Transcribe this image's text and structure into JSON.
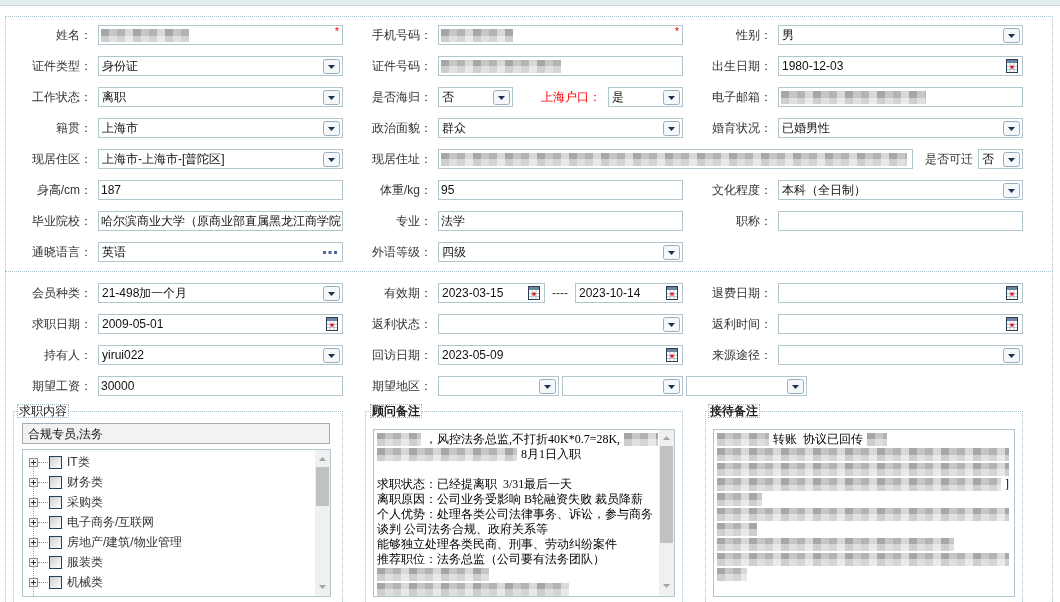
{
  "basic_info": {
    "rows": [
      [
        {
          "kind": "single",
          "label": "姓名：",
          "fields": [
            {
              "kind": "text",
              "redacted": true,
              "required_mark": "*"
            }
          ]
        },
        {
          "kind": "single",
          "label": "手机号码：",
          "fields": [
            {
              "kind": "text",
              "redacted": true,
              "required_mark": "*"
            }
          ]
        },
        {
          "kind": "single",
          "label": "性别：",
          "fields": [
            {
              "kind": "select",
              "value": "男"
            }
          ]
        }
      ],
      [
        {
          "kind": "single",
          "label": "证件类型：",
          "fields": [
            {
              "kind": "select",
              "value": "身份证"
            }
          ]
        },
        {
          "kind": "single",
          "label": "证件号码：",
          "fields": [
            {
              "kind": "text",
              "redacted": true
            }
          ]
        },
        {
          "kind": "single",
          "label": "出生日期：",
          "fields": [
            {
              "kind": "date",
              "value": "1980-12-03"
            }
          ]
        }
      ],
      [
        {
          "kind": "single",
          "label": "工作状态：",
          "fields": [
            {
              "kind": "select",
              "value": "离职"
            }
          ]
        },
        {
          "kind": "pair",
          "label": "是否海归：",
          "fields": [
            {
              "kind": "select",
              "value": "否"
            },
            {
              "kind": "label",
              "text": "上海户口：",
              "highlighted": true
            },
            {
              "kind": "select",
              "value": "是"
            }
          ]
        },
        {
          "kind": "single",
          "label": "电子邮箱：",
          "fields": [
            {
              "kind": "text",
              "redacted": true
            }
          ]
        }
      ],
      [
        {
          "kind": "single",
          "label": "籍贯：",
          "fields": [
            {
              "kind": "select",
              "value": "上海市"
            }
          ]
        },
        {
          "kind": "single",
          "label": "政治面貌：",
          "fields": [
            {
              "kind": "select",
              "value": "群众"
            }
          ]
        },
        {
          "kind": "single",
          "label": "婚育状况：",
          "fields": [
            {
              "kind": "select",
              "value": "已婚男性"
            }
          ]
        }
      ],
      [
        {
          "kind": "single",
          "label": "现居住区：",
          "fields": [
            {
              "kind": "select",
              "value": "上海市-上海市-[普陀区]"
            }
          ]
        },
        {
          "kind": "address",
          "label": "现居住址：",
          "fields": [
            {
              "kind": "text",
              "redacted": true
            },
            {
              "kind": "label",
              "text": "是否可迁",
              "highlighted": false
            },
            {
              "kind": "select",
              "value": "否"
            }
          ]
        }
      ],
      [
        {
          "kind": "single",
          "label": "身高/cm：",
          "fields": [
            {
              "kind": "text",
              "redacted": false,
              "value": "187"
            }
          ]
        },
        {
          "kind": "single",
          "label": "体重/kg：",
          "fields": [
            {
              "kind": "text",
              "redacted": false,
              "value": "95"
            }
          ]
        },
        {
          "kind": "single",
          "label": "文化程度：",
          "fields": [
            {
              "kind": "select",
              "value": "本科（全日制）"
            }
          ]
        }
      ],
      [
        {
          "kind": "single",
          "label": "毕业院校：",
          "fields": [
            {
              "kind": "text",
              "redacted": false,
              "value": "哈尔滨商业大学（原商业部直属黑龙江商学院"
            }
          ]
        },
        {
          "kind": "single",
          "label": "专业：",
          "fields": [
            {
              "kind": "text",
              "redacted": false,
              "value": "法学"
            }
          ]
        },
        {
          "kind": "single",
          "label": "职称：",
          "fields": [
            {
              "kind": "text",
              "redacted": false
            }
          ]
        }
      ],
      [
        {
          "kind": "single",
          "label": "通晓语言：",
          "fields": [
            {
              "kind": "lookup",
              "value": "英语"
            }
          ]
        },
        {
          "kind": "single",
          "label": "外语等级：",
          "fields": [
            {
              "kind": "select",
              "value": "四级"
            }
          ]
        }
      ]
    ]
  },
  "membership": {
    "rows": [
      [
        {
          "kind": "single",
          "label": "会员种类：",
          "fields": [
            {
              "kind": "select",
              "value": "21-498加一个月"
            }
          ]
        },
        {
          "kind": "range",
          "label": "有效期：",
          "fields": [
            {
              "kind": "date",
              "value": "2023-03-15"
            },
            {
              "kind": "separator",
              "text": "----"
            },
            {
              "kind": "date",
              "value": "2023-10-14"
            }
          ]
        },
        {
          "kind": "single",
          "label": "退费日期：",
          "fields": [
            {
              "kind": "date"
            }
          ]
        }
      ],
      [
        {
          "kind": "single",
          "label": "求职日期：",
          "fields": [
            {
              "kind": "date",
              "value": "2009-05-01"
            }
          ]
        },
        {
          "kind": "single",
          "label": "返利状态：",
          "fields": [
            {
              "kind": "select"
            }
          ]
        },
        {
          "kind": "single",
          "label": "返利时间：",
          "fields": [
            {
              "kind": "date"
            }
          ]
        }
      ],
      [
        {
          "kind": "single",
          "label": "持有人：",
          "fields": [
            {
              "kind": "select",
              "value": "yirui022"
            }
          ]
        },
        {
          "kind": "single",
          "label": "回访日期：",
          "fields": [
            {
              "kind": "date",
              "value": "2023-05-09"
            }
          ]
        },
        {
          "kind": "single",
          "label": "来源途径：",
          "fields": [
            {
              "kind": "select"
            }
          ]
        }
      ],
      [
        {
          "kind": "single",
          "label": "期望工资：",
          "fields": [
            {
              "kind": "text",
              "redacted": false,
              "value": "30000"
            }
          ]
        },
        {
          "kind": "region",
          "label": "期望地区：",
          "fields": [
            {
              "kind": "select"
            },
            {
              "kind": "select"
            },
            {
              "kind": "select"
            }
          ]
        }
      ]
    ]
  },
  "job_content": {
    "legend": "求职内容",
    "selection": "合规专员,法务",
    "tree": [
      {
        "label": "IT类",
        "expanded": false,
        "checked": false
      },
      {
        "label": "财务类",
        "expanded": false,
        "checked": false
      },
      {
        "label": "采购类",
        "expanded": false,
        "checked": false
      },
      {
        "label": "电子商务/互联网",
        "expanded": false,
        "checked": false
      },
      {
        "label": "房地产/建筑/物业管理",
        "expanded": false,
        "checked": false
      },
      {
        "label": "服装类",
        "expanded": false,
        "checked": false
      },
      {
        "label": "机械类",
        "expanded": false,
        "checked": false
      }
    ]
  },
  "consultant_notes": {
    "legend": "顾问备注",
    "lines": [
      {
        "kind": "text",
        "parts": [
          {
            "kind": "redacted"
          },
          {
            "kind": "text",
            "text": "，风控法务总监,不打折40K*0.7=28K,"
          },
          {
            "kind": "redacted"
          }
        ]
      },
      {
        "kind": "text",
        "parts": [
          {
            "kind": "redacted"
          },
          {
            "kind": "text",
            "text": "8月1日入职"
          }
        ]
      },
      {
        "kind": "blank"
      },
      {
        "kind": "text",
        "parts": [
          {
            "kind": "text",
            "text": "求职状态：已经提离职  3/31最后一天"
          }
        ]
      },
      {
        "kind": "text",
        "parts": [
          {
            "kind": "text",
            "text": "离职原因：公司业务受影响 B轮融资失败 裁员降薪"
          }
        ]
      },
      {
        "kind": "text",
        "parts": [
          {
            "kind": "text",
            "text": "个人优势：处理各类公司法律事务、诉讼，参与商务谈判 公司法务合规、政府关系等"
          }
        ]
      },
      {
        "kind": "text",
        "parts": [
          {
            "kind": "text",
            "text": "能够独立处理各类民商、刑事、劳动纠纷案件"
          }
        ]
      },
      {
        "kind": "text",
        "parts": [
          {
            "kind": "text",
            "text": "推荐职位：法务总监（公司要有法务团队）"
          }
        ]
      },
      {
        "kind": "text",
        "parts": [
          {
            "kind": "redacted"
          }
        ]
      },
      {
        "kind": "text",
        "parts": [
          {
            "kind": "redacted"
          }
        ]
      }
    ]
  },
  "reception_notes": {
    "legend": "接待备注",
    "lines": [
      {
        "kind": "text",
        "parts": [
          {
            "kind": "redacted"
          },
          {
            "kind": "text",
            "text": "转账  协议已回传"
          },
          {
            "kind": "redacted"
          }
        ]
      },
      {
        "kind": "text",
        "parts": [
          {
            "kind": "redacted"
          }
        ]
      },
      {
        "kind": "text",
        "parts": [
          {
            "kind": "redacted"
          }
        ]
      },
      {
        "kind": "text",
        "parts": [
          {
            "kind": "redacted"
          },
          {
            "kind": "text",
            "text": "]"
          }
        ]
      },
      {
        "kind": "text",
        "parts": [
          {
            "kind": "redacted"
          }
        ]
      },
      {
        "kind": "text",
        "parts": [
          {
            "kind": "redacted"
          }
        ]
      },
      {
        "kind": "text",
        "parts": [
          {
            "kind": "redacted"
          }
        ]
      },
      {
        "kind": "text",
        "parts": [
          {
            "kind": "redacted"
          }
        ]
      },
      {
        "kind": "text",
        "parts": [
          {
            "kind": "redacted"
          }
        ]
      },
      {
        "kind": "text",
        "parts": [
          {
            "kind": "redacted"
          }
        ]
      }
    ]
  }
}
